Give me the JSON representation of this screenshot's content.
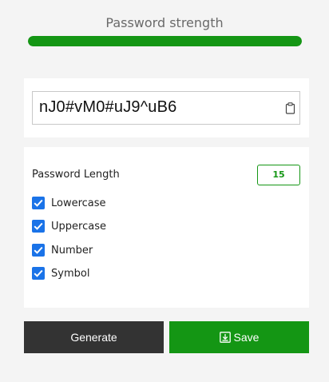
{
  "strength": {
    "title": "Password strength",
    "level_percent": 100,
    "color": "#149614"
  },
  "password": {
    "value": "nJ0#vM0#uJ9^uB6",
    "copy_icon": "clipboard-icon"
  },
  "options": {
    "length_label": "Password Length",
    "length_value": "15",
    "items": [
      {
        "label": "Lowercase",
        "checked": true
      },
      {
        "label": "Uppercase",
        "checked": true
      },
      {
        "label": "Number",
        "checked": true
      },
      {
        "label": "Symbol",
        "checked": true
      }
    ]
  },
  "actions": {
    "generate_label": "Generate",
    "save_label": "Save",
    "save_icon": "download-icon"
  },
  "colors": {
    "accent": "#149614",
    "checkbox": "#1a73e8",
    "generate_bg": "#333333"
  }
}
